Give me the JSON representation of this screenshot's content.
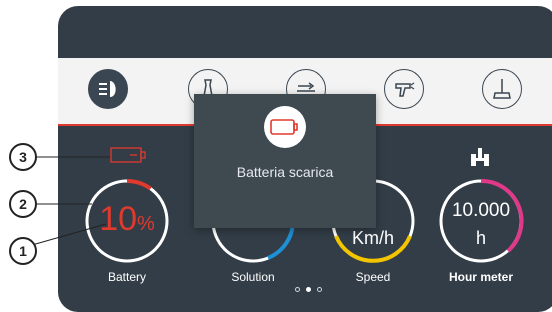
{
  "toolbar": {
    "items": [
      {
        "icon": "headlight-icon",
        "active": true
      },
      {
        "icon": "brush-icon",
        "active": false
      },
      {
        "icon": "squeegee-icon",
        "active": false
      },
      {
        "icon": "spray-gun-icon",
        "active": false
      },
      {
        "icon": "broom-icon",
        "active": false
      }
    ]
  },
  "alert": {
    "icon": "battery-empty-icon",
    "message": "Batteria scarica"
  },
  "gauges": {
    "battery": {
      "value": "10",
      "unit": "%",
      "label": "Battery",
      "level": 0.1,
      "color": "#e03a2e"
    },
    "solution": {
      "label": "Solution",
      "color": "#1f8fd6"
    },
    "speed": {
      "unit": "Km/h",
      "label": "Speed",
      "color": "#f2c500"
    },
    "hour_meter": {
      "value": "10.000",
      "unit": "h",
      "label": "Hour meter",
      "color": "#e0398a"
    }
  },
  "pager": {
    "count": 3,
    "active_index": 1
  },
  "callouts": {
    "c1": "1",
    "c2": "2",
    "c3": "3"
  },
  "colors": {
    "panel": "#323d47",
    "accent_red": "#e03a2e"
  }
}
